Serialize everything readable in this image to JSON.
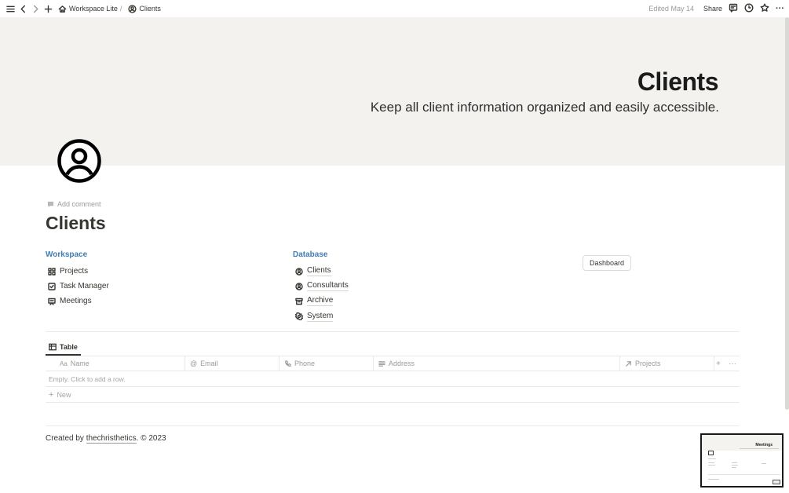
{
  "topbar": {
    "breadcrumb_workspace": "Workspace Lite",
    "breadcrumb_sep": "/",
    "breadcrumb_page": "Clients",
    "edited": "Edited May 14",
    "share": "Share"
  },
  "cover": {
    "title": "Clients",
    "subtitle": "Keep all client information organized and easily accessible."
  },
  "page": {
    "add_comment": "Add comment",
    "title": "Clients"
  },
  "workspace": {
    "heading": "Workspace",
    "items": [
      {
        "label": "Projects",
        "icon": "grid-icon"
      },
      {
        "label": "Task Manager",
        "icon": "checkbox-icon"
      },
      {
        "label": "Meetings",
        "icon": "presentation-icon"
      }
    ]
  },
  "database": {
    "heading": "Database",
    "items": [
      {
        "label": "Clients",
        "icon": "user-circle-icon"
      },
      {
        "label": "Consultants",
        "icon": "user-circle-icon"
      },
      {
        "label": "Archive",
        "icon": "archive-icon"
      },
      {
        "label": "System",
        "icon": "gear-icon"
      }
    ]
  },
  "dashboard_button": "Dashboard",
  "view_tab": "Table",
  "table": {
    "columns": [
      {
        "label": "Name",
        "icon": "text-icon",
        "prefix": "Aa"
      },
      {
        "label": "Email",
        "icon": "at-icon",
        "prefix": "@"
      },
      {
        "label": "Phone",
        "icon": "phone-icon"
      },
      {
        "label": "Address",
        "icon": "lines-icon"
      },
      {
        "label": "Projects",
        "icon": "arrow-up-right-icon"
      }
    ],
    "empty_text": "Empty. Click to add a row.",
    "new_label": "New",
    "add_symbol": "+",
    "more_symbol": "···"
  },
  "footer": {
    "prefix": "Created by",
    "author": "thechristhetics",
    "suffix": ". © 2023"
  },
  "minimap": {
    "title": "Meetings"
  }
}
